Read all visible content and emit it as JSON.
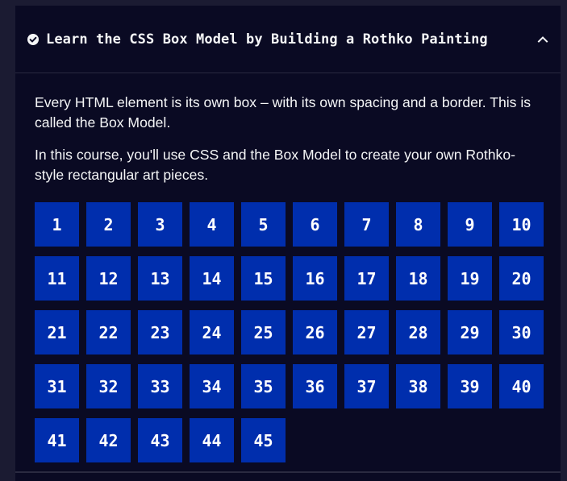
{
  "course": {
    "title": "Learn the CSS Box Model by Building a Rothko Painting",
    "completed_icon": "check-circle-icon",
    "toggle_icon": "chevron-up-icon"
  },
  "description": [
    "Every HTML element is its own box – with its own spacing and a border. This is called the Box Model.",
    "In this course, you'll use CSS and the Box Model to create your own Rothko-style rectangular art pieces."
  ],
  "steps": [
    "1",
    "2",
    "3",
    "4",
    "5",
    "6",
    "7",
    "8",
    "9",
    "10",
    "11",
    "12",
    "13",
    "14",
    "15",
    "16",
    "17",
    "18",
    "19",
    "20",
    "21",
    "22",
    "23",
    "24",
    "25",
    "26",
    "27",
    "28",
    "29",
    "30",
    "31",
    "32",
    "33",
    "34",
    "35",
    "36",
    "37",
    "38",
    "39",
    "40",
    "41",
    "42",
    "43",
    "44",
    "45"
  ],
  "colors": {
    "page_background": "#1b1b32",
    "panel_background": "#0a0a23",
    "step_background": "#002ead",
    "text": "#f5f6f7"
  }
}
